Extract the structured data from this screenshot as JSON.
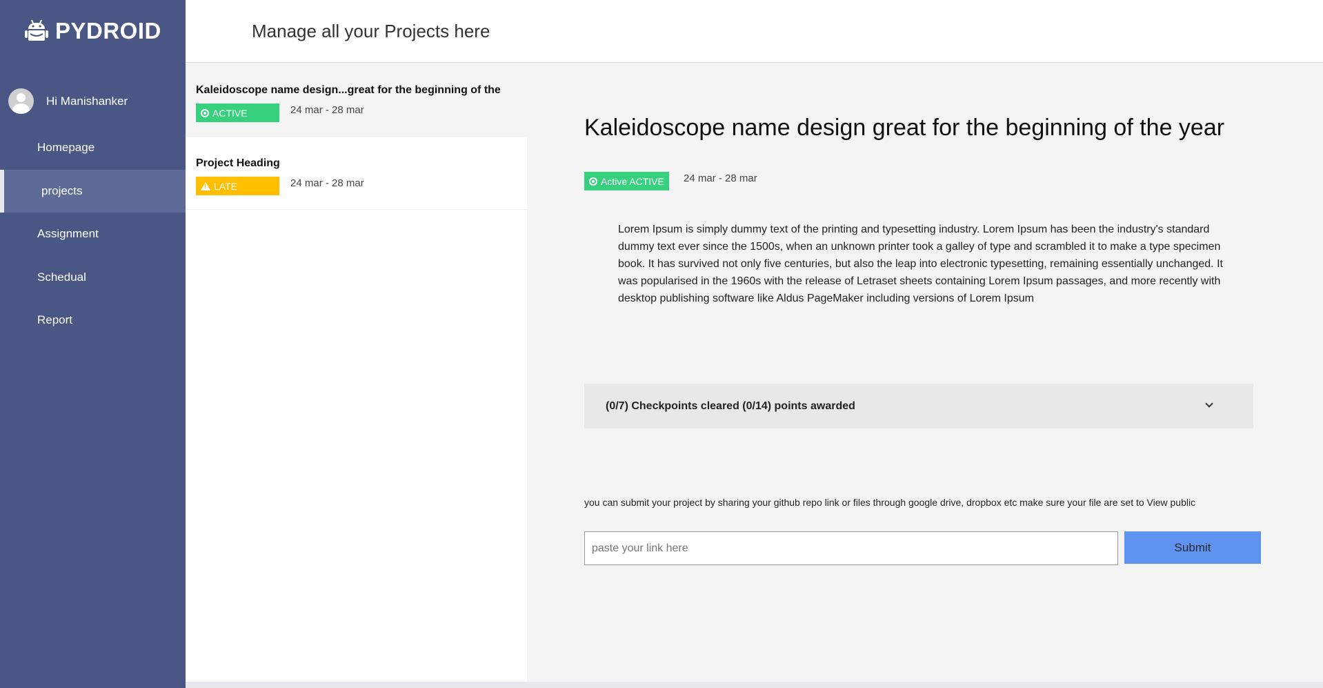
{
  "brand": {
    "name": "PYDROID",
    "icon": "android-robot-icon"
  },
  "user": {
    "greeting": "Hi Manishanker"
  },
  "nav": {
    "items": [
      {
        "label": "Homepage"
      },
      {
        "label": "projects",
        "active": true
      },
      {
        "label": "Assignment"
      },
      {
        "label": "Schedual"
      },
      {
        "label": "Report"
      }
    ]
  },
  "header": {
    "title": "Manage all your Projects here"
  },
  "projects": [
    {
      "title": "Kaleidoscope name design...great for the beginning of the",
      "status": "ACTIVE",
      "dates": "24 mar - 28 mar",
      "status_color": "#36d07f"
    },
    {
      "title": "Project Heading",
      "status": "LATE",
      "dates": "24 mar - 28 mar",
      "status_color": "#ffbf00"
    }
  ],
  "detail": {
    "title": "Kaleidoscope name design great for the beginning of the year",
    "status": "Active ACTIVE",
    "dates": "24 mar - 28 mar",
    "description": "Lorem Ipsum is simply dummy text of the printing and typesetting industry. Lorem Ipsum has been the industry's standard dummy text ever since the 1500s, when an unknown printer took a galley of type and scrambled it to make a type specimen book. It has survived not only five centuries, but also the leap into electronic typesetting, remaining essentially unchanged. It was popularised in the 1960s with the release of Letraset sheets containing Lorem Ipsum passages, and more recently with desktop publishing software like Aldus PageMaker including versions of Lorem Ipsum",
    "checkpoints_label": "(0/7) Checkpoints cleared (0/14) points awarded",
    "submit_note": "you can submit your project by sharing your github repo link or files through google drive, dropbox etc make sure your file are set to View public",
    "link_placeholder": "paste your link here",
    "submit_label": "Submit"
  },
  "colors": {
    "sidebar": "#4a5683",
    "active": "#36d07f",
    "late": "#ffbf00",
    "submit": "#5f93ef"
  }
}
